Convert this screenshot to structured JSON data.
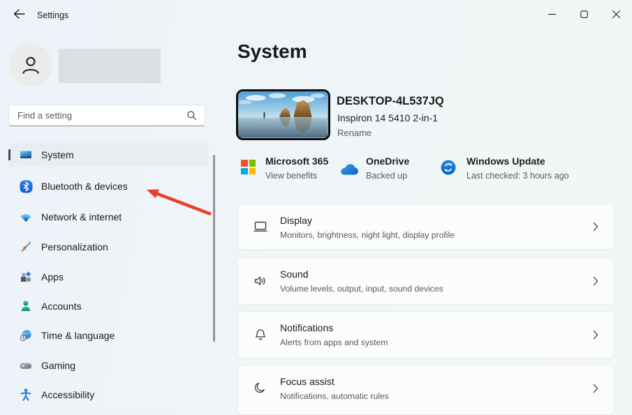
{
  "titlebar": {
    "title": "Settings",
    "controls": [
      "minimize",
      "maximize",
      "close"
    ]
  },
  "sidebar": {
    "search_placeholder": "Find a setting",
    "items": [
      {
        "label": "System",
        "icon": "system-laptop-icon",
        "selected": true
      },
      {
        "label": "Bluetooth & devices",
        "icon": "bluetooth-icon",
        "selected": false
      },
      {
        "label": "Network & internet",
        "icon": "wifi-icon",
        "selected": false
      },
      {
        "label": "Personalization",
        "icon": "paintbrush-icon",
        "selected": false
      },
      {
        "label": "Apps",
        "icon": "apps-grid-icon",
        "selected": false
      },
      {
        "label": "Accounts",
        "icon": "person-icon",
        "selected": false
      },
      {
        "label": "Time & language",
        "icon": "clock-globe-icon",
        "selected": false
      },
      {
        "label": "Gaming",
        "icon": "gamepad-icon",
        "selected": false
      },
      {
        "label": "Accessibility",
        "icon": "accessibility-icon",
        "selected": false
      }
    ]
  },
  "main": {
    "title": "System",
    "device": {
      "name": "DESKTOP-4L537JQ",
      "model": "Inspiron 14 5410 2-in-1",
      "rename_label": "Rename"
    },
    "status_items": [
      {
        "title": "Microsoft 365",
        "subtitle": "View benefits",
        "icon": "microsoft-365-icon"
      },
      {
        "title": "OneDrive",
        "subtitle": "Backed up",
        "icon": "onedrive-cloud-icon"
      },
      {
        "title": "Windows Update",
        "subtitle": "Last checked: 3 hours ago",
        "icon": "windows-update-icon"
      }
    ],
    "settings_rows": [
      {
        "title": "Display",
        "subtitle": "Monitors, brightness, night light, display profile",
        "icon": "display-icon"
      },
      {
        "title": "Sound",
        "subtitle": "Volume levels, output, input, sound devices",
        "icon": "speaker-icon"
      },
      {
        "title": "Notifications",
        "subtitle": "Alerts from apps and system",
        "icon": "bell-icon"
      },
      {
        "title": "Focus assist",
        "subtitle": "Notifications, automatic rules",
        "icon": "moon-icon"
      }
    ]
  },
  "annotations": {
    "arrow": {
      "color": "#e8402e",
      "points_to": "Bluetooth & devices"
    }
  },
  "colors": {
    "accent_pill": "#3f4a58",
    "ms365": [
      "#f25022",
      "#7fba00",
      "#00a4ef",
      "#ffb900"
    ],
    "selected_nav_bg": "#e9edf2"
  }
}
